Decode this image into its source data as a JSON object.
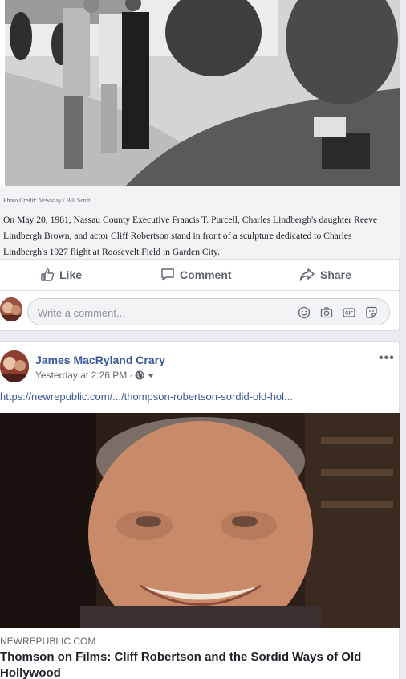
{
  "post1": {
    "photo_credit": "Photo Credit: Newsday / Bill Senft",
    "caption": "On May 20, 1981, Nassau County Executive Francis T. Purcell, Charles Lindbergh's daughter Reeve Lindbergh Brown, and actor Cliff Robertson stand in front of a sculpture dedicated to Charles Lindbergh's 1927 flight at Roosevelt Field in Garden City.",
    "actions": {
      "like": "Like",
      "comment": "Comment",
      "share": "Share"
    },
    "comment_placeholder": "Write a comment..."
  },
  "post2": {
    "author": "James MacRyland Crary",
    "timestamp": "Yesterday at 2:26 PM",
    "more": "•••",
    "link_text": "https://newrepublic.com/.../thompson-robertson-sordid-old-hol...",
    "link_domain": "NEWREPUBLIC.COM",
    "link_title": "Thomson on Films: Cliff Robertson and the Sordid Ways of Old Hollywood"
  },
  "colors": {
    "link_blue": "#385898",
    "secondary_text": "#606770",
    "background": "#e9ebee"
  }
}
